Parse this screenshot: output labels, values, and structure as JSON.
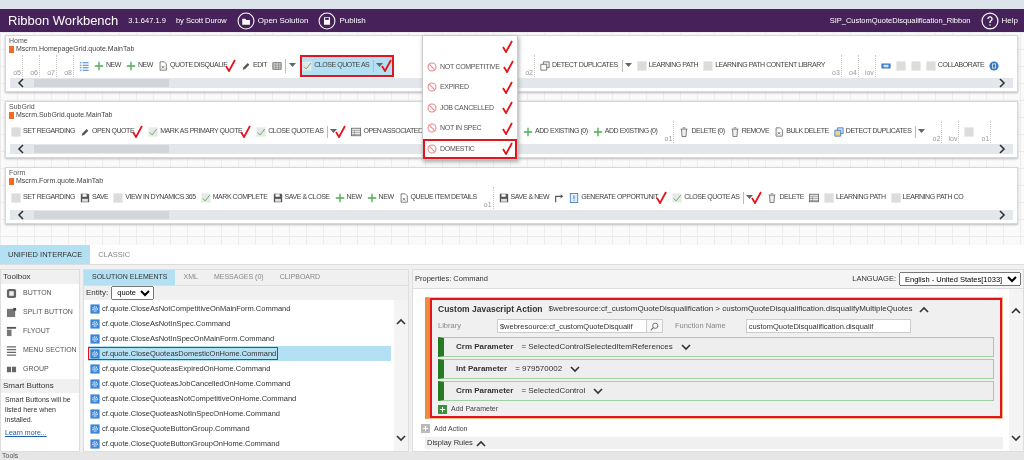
{
  "header": {
    "title": "Ribbon Workbench",
    "version": "3.1.647.1.9",
    "author": "by Scott Durow",
    "actions": [
      {
        "label": "Open Solution"
      },
      {
        "label": "Publish"
      }
    ],
    "solution": "SIP_CustomQuoteDisqualification_Ribbon",
    "help": "Help"
  },
  "ribbons": [
    {
      "tab": "Home",
      "id": "Mscrm.HomepageGrid.quote.MainTab",
      "items": [
        {
          "kind": "group",
          "label": "o5"
        },
        {
          "kind": "group",
          "label": "o6"
        },
        {
          "kind": "group",
          "label": "o7"
        },
        {
          "kind": "group",
          "label": "o8"
        },
        {
          "kind": "list"
        },
        {
          "kind": "plus",
          "label": "NEW"
        },
        {
          "kind": "plus",
          "label": "NEW"
        },
        {
          "kind": "document",
          "label": "QUOTE DISQUALIF",
          "annotated": true
        },
        {
          "kind": "pencil",
          "label": "EDIT"
        },
        {
          "kind": "grid"
        },
        {
          "kind": "dropdown"
        },
        {
          "kind": "check",
          "label": "CLOSE QUOTE AS",
          "split": true,
          "annotated": true,
          "selected": true,
          "highlighted": true,
          "menu": [
            {
              "kind": "header",
              "annotated": true
            },
            {
              "kind": "option",
              "label": "NOT COMPETITIVE",
              "annotated": true,
              "highlighted": false
            },
            {
              "kind": "option",
              "label": "EXPIRED",
              "annotated": true,
              "highlighted": false
            },
            {
              "kind": "option",
              "label": "JOB CANCELLED",
              "annotated": true,
              "highlighted": false
            },
            {
              "kind": "option",
              "label": "NOT IN SPEC",
              "annotated": true,
              "highlighted": false
            },
            {
              "kind": "option",
              "label": "DOMESTIC",
              "annotated": true,
              "highlighted": true
            }
          ]
        }
      ],
      "items_after_menu": [
        {
          "kind": "group",
          "label": "o2"
        },
        {
          "kind": "copy",
          "label": "DETECT DUPLICATES",
          "split": true
        },
        {
          "kind": "blank",
          "label": "LEARNING PATH"
        },
        {
          "kind": "blank",
          "label": "LEARNING PATH CONTENT LIBRARY"
        },
        {
          "kind": "group",
          "label": "o3"
        },
        {
          "kind": "group",
          "label": "o4"
        },
        {
          "kind": "group",
          "label": "iov"
        },
        {
          "kind": "card"
        },
        {
          "kind": "blank"
        },
        {
          "kind": "blank"
        },
        {
          "kind": "blank",
          "label": "COLLABORATE"
        },
        {
          "kind": "circle"
        }
      ]
    },
    {
      "tab": "SubGrid",
      "id": "Mscrm.SubGrid.quote.MainTab",
      "items": [
        {
          "kind": "blank",
          "label": "SET REGARDING"
        },
        {
          "kind": "pencil",
          "label": "OPEN QUOTE",
          "annotated": true
        },
        {
          "kind": "check",
          "label": "MARK AS PRIMARY QUOTE",
          "annotated": true
        },
        {
          "kind": "check",
          "label": "CLOSE QUOTE AS",
          "split": true,
          "annotated": true
        },
        {
          "kind": "table",
          "label": "OPEN ASSOCIATED"
        }
      ],
      "items_after_menu": [
        {
          "kind": "plus",
          "label": "ADD EXISTING (0)"
        },
        {
          "kind": "plus",
          "label": "ADD EXISTING (0)"
        },
        {
          "kind": "group",
          "label": "o1"
        },
        {
          "kind": "trash",
          "label": "DELETE (0)"
        },
        {
          "kind": "trash",
          "label": "REMOVE"
        },
        {
          "kind": "document",
          "label": "BULK DELETE"
        },
        {
          "kind": "detect",
          "label": "DETECT DUPLICATES",
          "split": true
        },
        {
          "kind": "group",
          "label": "o2"
        },
        {
          "kind": "group",
          "label": "iov"
        },
        {
          "kind": "blank"
        },
        {
          "kind": "group",
          "label": "o1"
        }
      ]
    },
    {
      "tab": "Form",
      "id": "Mscrm.Form.quote.MainTab",
      "items": [
        {
          "kind": "blank",
          "label": "SET REGARDING"
        },
        {
          "kind": "floppy",
          "label": "SAVE"
        },
        {
          "kind": "blank",
          "label": "VIEW IN DYNAMICS 365"
        },
        {
          "kind": "check",
          "label": "MARK COMPLETE"
        },
        {
          "kind": "floppy",
          "label": "SAVE & CLOSE"
        },
        {
          "kind": "plus",
          "label": "NEW"
        },
        {
          "kind": "plus",
          "label": "NEW"
        },
        {
          "kind": "document",
          "label": "QUEUE ITEM DETAILS"
        },
        {
          "kind": "group",
          "label": "o1"
        },
        {
          "kind": "floppy",
          "label": "SAVE & NEW"
        },
        {
          "kind": "arrow"
        },
        {
          "kind": "alert",
          "label": "GENERATE OPPORTUNIT",
          "annotated": true
        },
        {
          "kind": "check",
          "label": "CLOSE QUOTE AS",
          "split": true,
          "annotated": true
        },
        {
          "kind": "trash",
          "label": "DELETE"
        },
        {
          "kind": "table"
        },
        {
          "kind": "blank",
          "label": "LEARNING PATH"
        },
        {
          "kind": "blank",
          "label": "LEARNING PATH CO"
        }
      ]
    }
  ],
  "view_tabs": [
    {
      "label": "UNIFIED INTERFACE",
      "selected": true
    },
    {
      "label": "CLASSIC",
      "selected": false
    }
  ],
  "toolbox": {
    "title": "Toolbox",
    "items": [
      {
        "kind": "button",
        "label": "BUTTON"
      },
      {
        "kind": "split",
        "label": "SPLIT BUTTON"
      },
      {
        "kind": "flyout",
        "label": "FLYOUT"
      },
      {
        "kind": "section",
        "label": "MENU SECTION"
      },
      {
        "kind": "group",
        "label": "GROUP"
      }
    ],
    "smart_title": "Smart Buttons",
    "smart_text": "Smart Buttons will be listed here when installed.",
    "link": "Learn more..."
  },
  "elements": {
    "tabs": [
      {
        "label": "SOLUTION ELEMENTS",
        "selected": true
      },
      {
        "label": "XML",
        "selected": false
      },
      {
        "label": "MESSAGES (0)",
        "selected": false
      },
      {
        "label": "CLIPBOARD",
        "selected": false
      }
    ],
    "entity_label": "Entity:",
    "entity": "quote",
    "items": [
      {
        "label": "cf.quote.CloseAsNotCompetitiveOnMainForm.Command",
        "selected": false,
        "highlighted": false
      },
      {
        "label": "cf.quote.CloseAsNotInSpec.Command",
        "selected": false,
        "highlighted": false
      },
      {
        "label": "cf.quote.CloseAsNotInSpecOnMainForm.Command",
        "selected": false,
        "highlighted": false
      },
      {
        "label": "cf.quote.CloseQuoteasDomesticOnHome.Command",
        "selected": true,
        "highlighted": true
      },
      {
        "label": "cf.quote.CloseQuoteasExpiredOnHome.Command",
        "selected": false,
        "highlighted": false
      },
      {
        "label": "cf.quote.CloseQuoteasJobCancelledOnHome.Command",
        "selected": false,
        "highlighted": false
      },
      {
        "label": "cf.quote.CloseQuoteasNotCompetitiveOnHome.Command",
        "selected": false,
        "highlighted": false
      },
      {
        "label": "cf.quote.CloseQuoteasNotInSpecOnHome.Command",
        "selected": false,
        "highlighted": false
      },
      {
        "label": "cf.quote.CloseQuoteButtonGroup.Command",
        "selected": false,
        "highlighted": false
      },
      {
        "label": "cf.quote.CloseQuoteButtonGroupOnHome.Command",
        "selected": false,
        "highlighted": false
      }
    ]
  },
  "properties": {
    "title": "Properties: Command",
    "language_label": "LANGUAGE:",
    "language": "English - United States[1033]",
    "action": {
      "title": "Custom Javascript Action",
      "summary": "$webresource:cf_customQuoteDisqualification > customQuoteDisqualification.disqualifyMultipleQuotes",
      "expanded": true,
      "highlighted": true,
      "library_label": "Library",
      "library": "$webresource:cf_customQuoteDisqualif",
      "function_label": "Function Name",
      "function": "customQuoteDisqualification.disqualif",
      "parameters": [
        {
          "type": "Crm Parameter",
          "value": "= SelectedControlSelectedItemReferences",
          "expanded": false
        },
        {
          "type": "Int Parameter",
          "value": "= 979570002",
          "expanded": false
        },
        {
          "type": "Crm Parameter",
          "value": "= SelectedControl",
          "expanded": false
        }
      ],
      "add_parameter": "Add Parameter"
    },
    "add_action": "Add Action",
    "display_rules": "Display Rules",
    "display_rules_expanded": true
  },
  "status_bar": "Tools"
}
